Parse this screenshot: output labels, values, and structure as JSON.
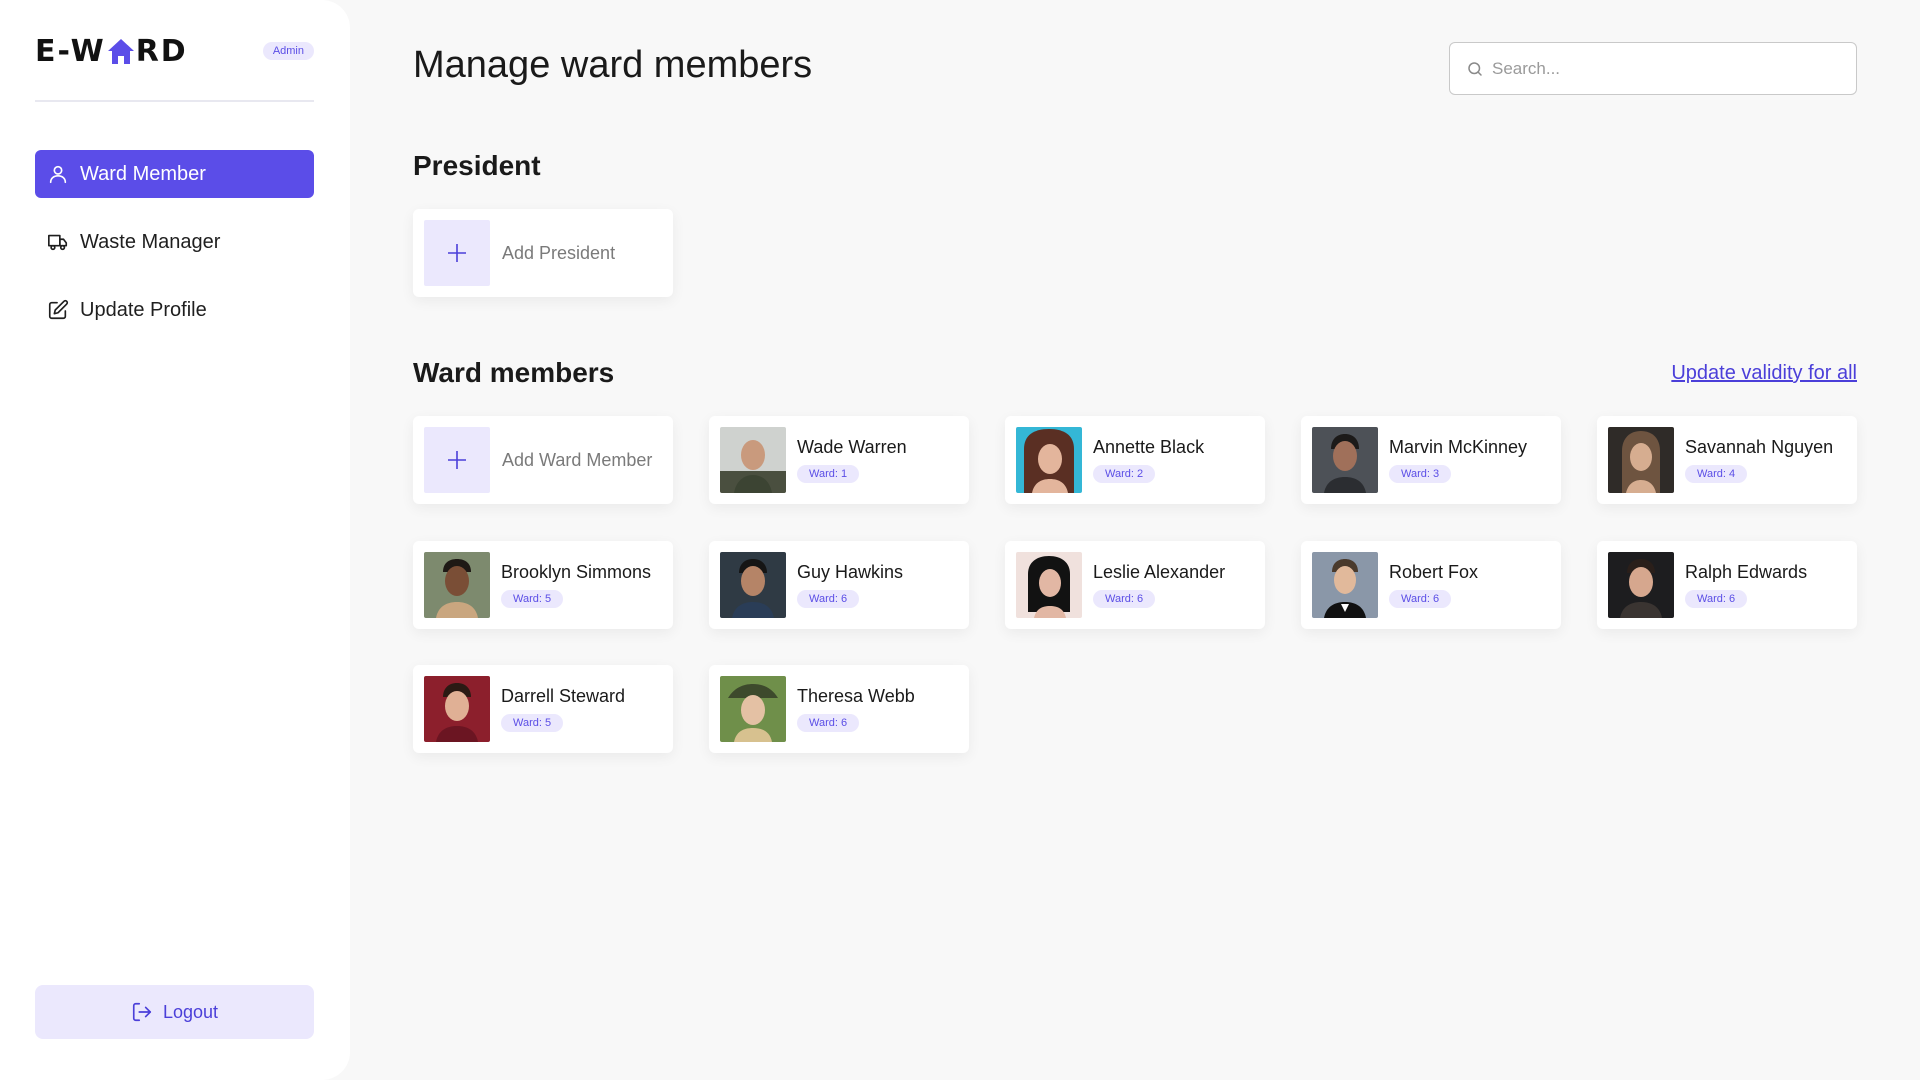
{
  "brand": {
    "logo_left": "E-W",
    "logo_right": "RD",
    "role_badge": "Admin"
  },
  "sidebar": {
    "items": [
      {
        "label": "Ward Member",
        "icon": "user-icon",
        "active": true
      },
      {
        "label": "Waste Manager",
        "icon": "truck-icon",
        "active": false
      },
      {
        "label": "Update Profile",
        "icon": "edit-icon",
        "active": false
      }
    ],
    "logout_label": "Logout"
  },
  "main": {
    "title": "Manage ward members",
    "search_placeholder": "Search...",
    "president_section": "President",
    "add_president_label": "Add President",
    "members_section": "Ward members",
    "update_validity_label": "Update validity for all",
    "add_member_label": "Add Ward Member",
    "members": [
      {
        "name": "Wade Warren",
        "ward": "Ward: 1"
      },
      {
        "name": "Annette Black",
        "ward": "Ward: 2"
      },
      {
        "name": "Marvin McKinney",
        "ward": "Ward: 3"
      },
      {
        "name": "Savannah Nguyen",
        "ward": "Ward: 4"
      },
      {
        "name": "Brooklyn Simmons",
        "ward": "Ward: 5"
      },
      {
        "name": "Guy Hawkins",
        "ward": "Ward: 6"
      },
      {
        "name": "Leslie Alexander",
        "ward": "Ward: 6"
      },
      {
        "name": "Robert Fox",
        "ward": "Ward: 6"
      },
      {
        "name": "Ralph Edwards",
        "ward": "Ward: 6"
      },
      {
        "name": "Darrell Steward",
        "ward": "Ward: 5"
      },
      {
        "name": "Theresa Webb",
        "ward": "Ward: 6"
      }
    ]
  },
  "colors": {
    "accent": "#5b4de8",
    "accent_light": "#ebe8fd",
    "background": "#f8f8f8"
  }
}
